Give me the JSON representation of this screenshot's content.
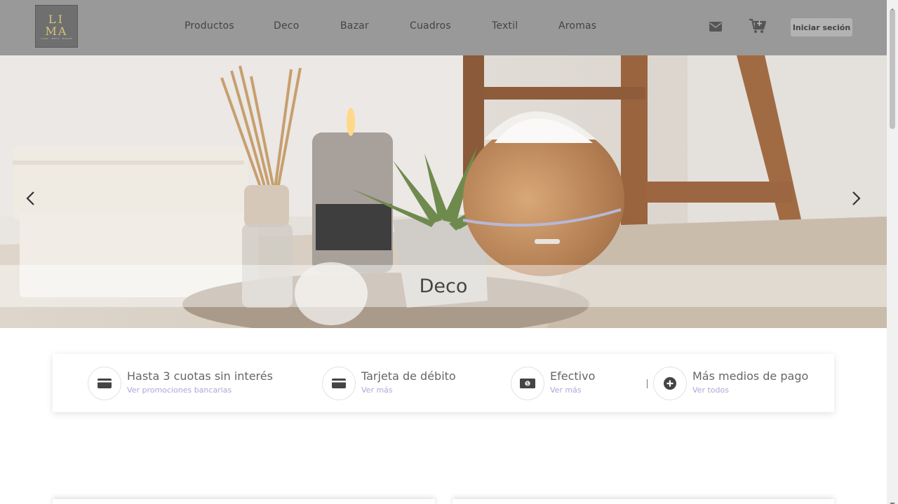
{
  "brand": {
    "logo_top": "LI",
    "logo_bottom": "MA",
    "logo_tagline": "CASA · DECO · BAZAR"
  },
  "nav": {
    "items": [
      "Productos",
      "Deco",
      "Bazar",
      "Cuadros",
      "Textil",
      "Aromas"
    ]
  },
  "header": {
    "login_label": "Iniciar seción",
    "icons": [
      "mail-icon",
      "cart-icon"
    ]
  },
  "hero": {
    "title": "Deco"
  },
  "payments": [
    {
      "title": "Hasta 3 cuotas sin interés",
      "link": "Ver promociones bancarias",
      "icon": "credit-card-icon"
    },
    {
      "title": "Tarjeta de débito",
      "link": "Ver más",
      "icon": "debit-card-icon"
    },
    {
      "title": "Efectivo",
      "link": "Ver más",
      "icon": "cash-icon"
    },
    {
      "title": "Más medios de pago",
      "link": "Ver todos",
      "icon": "plus-circle-icon"
    }
  ],
  "colors": {
    "header_bg": "#999999",
    "link_color": "#aaa8d8",
    "login_bg": "#b3b3b3"
  }
}
